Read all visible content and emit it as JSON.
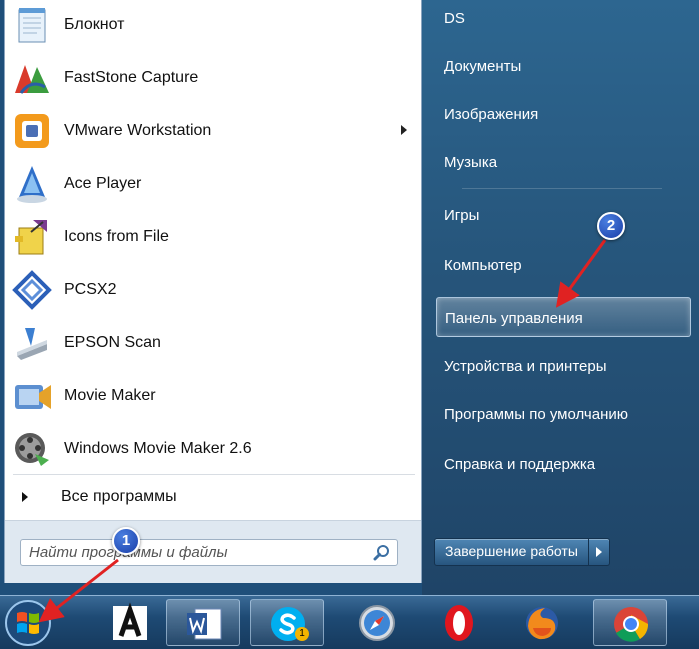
{
  "programs": [
    {
      "label": "Блокнот",
      "icon": "notepad-icon",
      "submenu": false
    },
    {
      "label": "FastStone Capture",
      "icon": "faststone-capture-icon",
      "submenu": false
    },
    {
      "label": "VMware Workstation",
      "icon": "vmware-icon",
      "submenu": true
    },
    {
      "label": "Ace Player",
      "icon": "ace-player-icon",
      "submenu": false
    },
    {
      "label": "Icons from File",
      "icon": "icons-from-file-icon",
      "submenu": false
    },
    {
      "label": "PCSX2",
      "icon": "pcsx2-icon",
      "submenu": false
    },
    {
      "label": "EPSON Scan",
      "icon": "epson-scan-icon",
      "submenu": false
    },
    {
      "label": "Movie Maker",
      "icon": "movie-maker-icon",
      "submenu": false
    },
    {
      "label": "Windows Movie Maker 2.6",
      "icon": "windows-movie-maker-icon",
      "submenu": false
    }
  ],
  "all_programs_label": "Все программы",
  "search": {
    "placeholder": "Найти программы и файлы"
  },
  "places": [
    {
      "label": "DS"
    },
    {
      "label": "Документы"
    },
    {
      "label": "Изображения"
    },
    {
      "label": "Музыка"
    },
    {
      "label": "Игры"
    },
    {
      "label": "Компьютер"
    },
    {
      "label": "Панель управления",
      "highlighted": true
    },
    {
      "label": "Устройства и принтеры"
    },
    {
      "label": "Программы по умолчанию"
    },
    {
      "label": "Справка и поддержка"
    }
  ],
  "shutdown_label": "Завершение работы",
  "taskbar": [
    {
      "name": "font-viewer-icon"
    },
    {
      "name": "word-icon"
    },
    {
      "name": "skype-icon",
      "badge": "1"
    },
    {
      "name": "safari-icon"
    },
    {
      "name": "opera-icon"
    },
    {
      "name": "firefox-icon"
    },
    {
      "name": "chrome-icon"
    }
  ],
  "annotations": [
    "1",
    "2"
  ],
  "colors": {
    "highlight_arrow": "#e02222",
    "badge": "#1a3ea8",
    "right_pane": "#26557b"
  }
}
